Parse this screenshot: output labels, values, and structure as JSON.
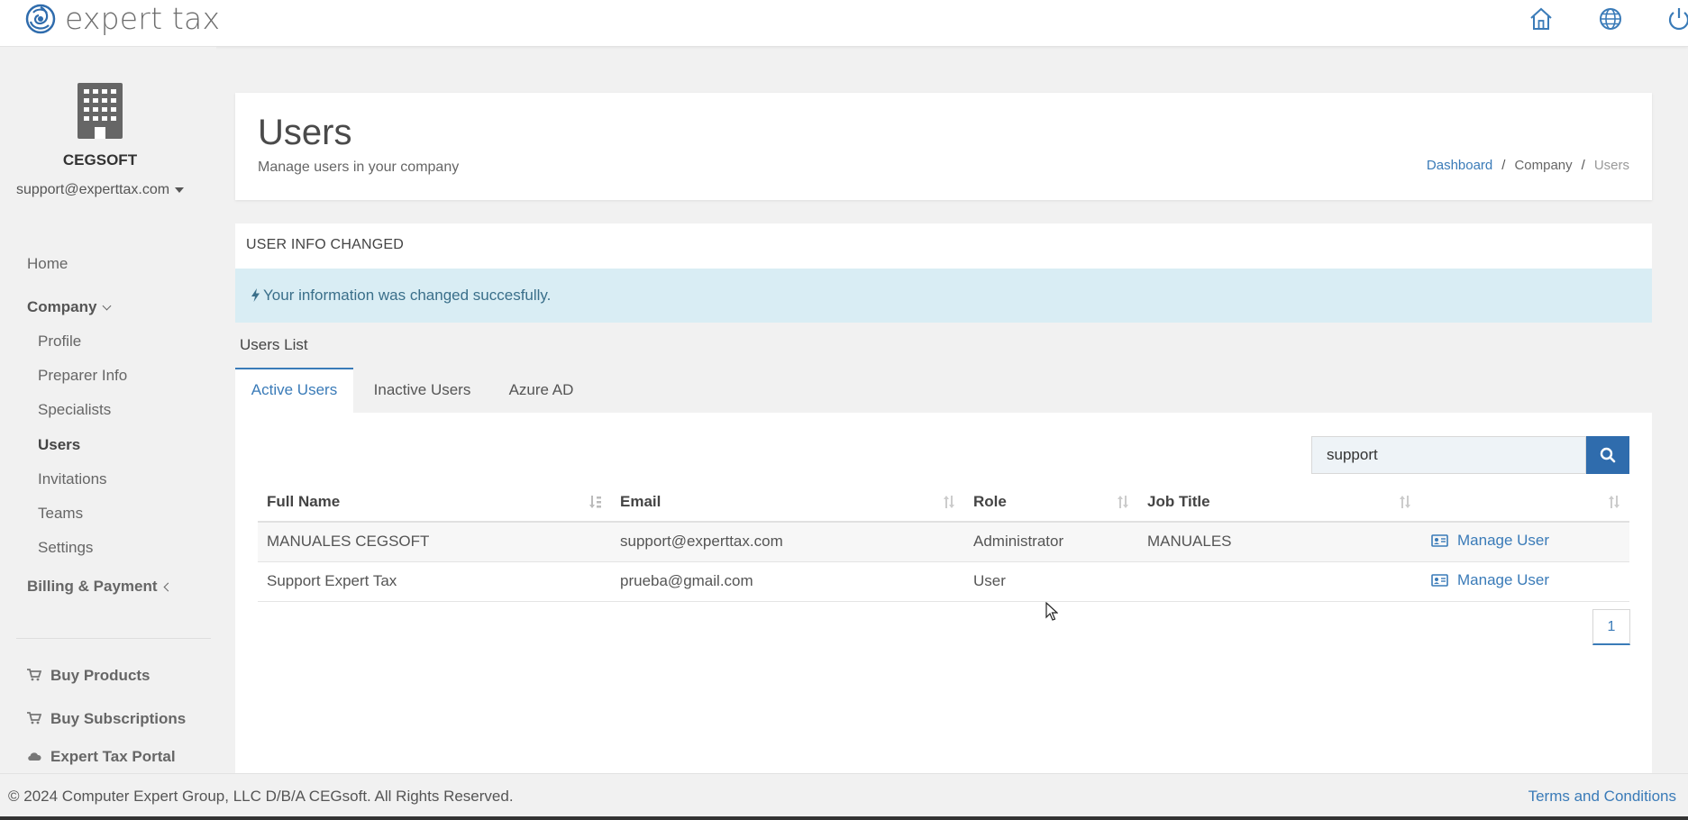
{
  "app": {
    "logo_text": "expert tax",
    "icons": [
      "home-icon",
      "globe-icon",
      "power-icon"
    ]
  },
  "sidebar": {
    "company_name": "CEGSOFT",
    "user_email": "support@experttax.com",
    "items": [
      {
        "label": "Home"
      },
      {
        "label": "Company"
      },
      {
        "label": "Profile"
      },
      {
        "label": "Preparer Info"
      },
      {
        "label": "Specialists"
      },
      {
        "label": "Users"
      },
      {
        "label": "Invitations"
      },
      {
        "label": "Teams"
      },
      {
        "label": "Settings"
      },
      {
        "label": "Billing & Payment"
      },
      {
        "label": "Buy Products"
      },
      {
        "label": "Buy Subscriptions"
      },
      {
        "label": "Expert Tax Portal"
      }
    ]
  },
  "header": {
    "title": "Users",
    "subtitle": "Manage users in your company",
    "breadcrumb": [
      "Dashboard",
      "Company",
      "Users"
    ]
  },
  "alert": {
    "title": "USER INFO CHANGED",
    "message": "Your information was changed succesfully."
  },
  "users_list": {
    "title": "Users List",
    "tabs": [
      "Active Users",
      "Inactive Users",
      "Azure AD"
    ],
    "active_tab": "Active Users",
    "search_value": "support",
    "columns": [
      "Full Name",
      "Email",
      "Role",
      "Job Title",
      ""
    ],
    "rows": [
      {
        "full_name": "MANUALES CEGSOFT",
        "email": "support@experttax.com",
        "role": "Administrator",
        "job_title": "MANUALES",
        "action": "Manage User"
      },
      {
        "full_name": "Support Expert Tax",
        "email": "prueba@gmail.com",
        "role": "User",
        "job_title": "",
        "action": "Manage User"
      }
    ],
    "page": "1"
  },
  "footer": {
    "copyright": "© 2024 Computer Expert Group, LLC D/B/A CEGsoft. All Rights Reserved.",
    "terms": "Terms and Conditions"
  },
  "colors": {
    "accent": "#3a7bb8",
    "search_button": "#2f6cad",
    "alert_bg": "#d9edf4"
  }
}
